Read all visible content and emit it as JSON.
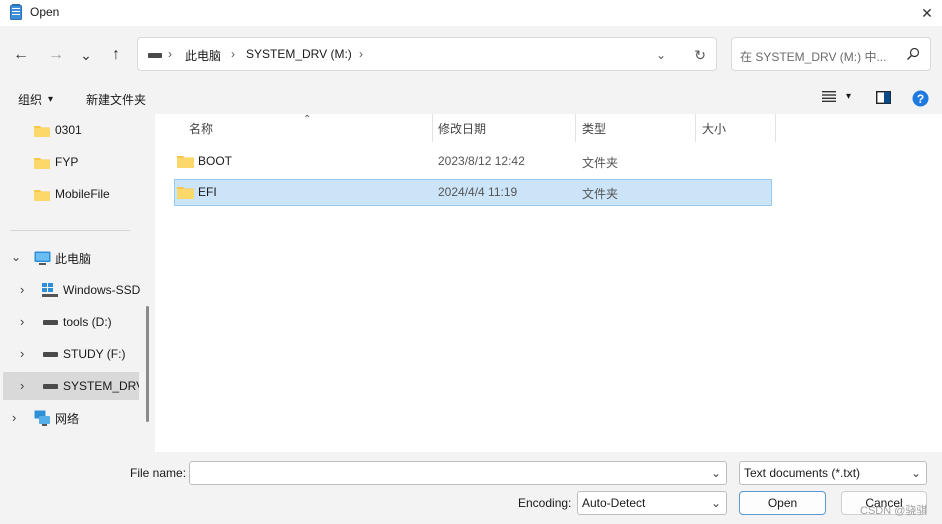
{
  "window": {
    "title": "Open",
    "close_glyph": "✕"
  },
  "nav": {
    "back_glyph": "←",
    "forward_glyph": "→",
    "recent_glyph": "⌄",
    "up_glyph": "↑"
  },
  "address": {
    "crumbs": [
      "此电脑",
      "SYSTEM_DRV (M:)"
    ],
    "separator": "›",
    "dropdown_glyph": "⌄",
    "refresh_glyph": "↻"
  },
  "search": {
    "placeholder": "在 SYSTEM_DRV (M:) 中...",
    "icon": "search-icon"
  },
  "toolbar": {
    "organize_label": "组织",
    "organize_caret": "▾",
    "new_folder_label": "新建文件夹",
    "view_caret": "▾"
  },
  "sidebar": {
    "items": [
      {
        "label": "0301",
        "icon": "folder-icon"
      },
      {
        "label": "FYP",
        "icon": "folder-icon"
      },
      {
        "label": "MobileFile",
        "icon": "folder-icon"
      },
      {
        "label": "此电脑",
        "icon": "pc-icon",
        "expanded": true
      },
      {
        "label": "Windows-SSD",
        "icon": "windows-drive-icon"
      },
      {
        "label": "tools (D:)",
        "icon": "drive-icon"
      },
      {
        "label": "STUDY (F:)",
        "icon": "drive-icon"
      },
      {
        "label": "SYSTEM_DRV",
        "icon": "drive-icon",
        "selected": true
      },
      {
        "label": "网络",
        "icon": "network-icon"
      }
    ],
    "expand_glyph": "›",
    "collapse_glyph": "⌄"
  },
  "columns": {
    "sort_glyph": "⌃",
    "headers": [
      "名称",
      "修改日期",
      "类型",
      "大小"
    ]
  },
  "files": [
    {
      "name": "BOOT",
      "modified": "2023/8/12 12:42",
      "type": "文件夹",
      "size": "",
      "selected": false
    },
    {
      "name": "EFI",
      "modified": "2024/4/4 11:19",
      "type": "文件夹",
      "size": "",
      "selected": true
    }
  ],
  "footer": {
    "file_name_label": "File name:",
    "file_name_value": "",
    "file_type_value": "Text documents (*.txt)",
    "encoding_label": "Encoding:",
    "encoding_value": "Auto-Detect",
    "open_label": "Open",
    "cancel_label": "Cancel",
    "dropdown_glyph": "⌄",
    "watermark": "CSDN @骁骐"
  },
  "colors": {
    "accent": "#0067c0",
    "selection": "#cce4f7",
    "selection_border": "#99c9ef",
    "folder": "#f8c74a"
  }
}
